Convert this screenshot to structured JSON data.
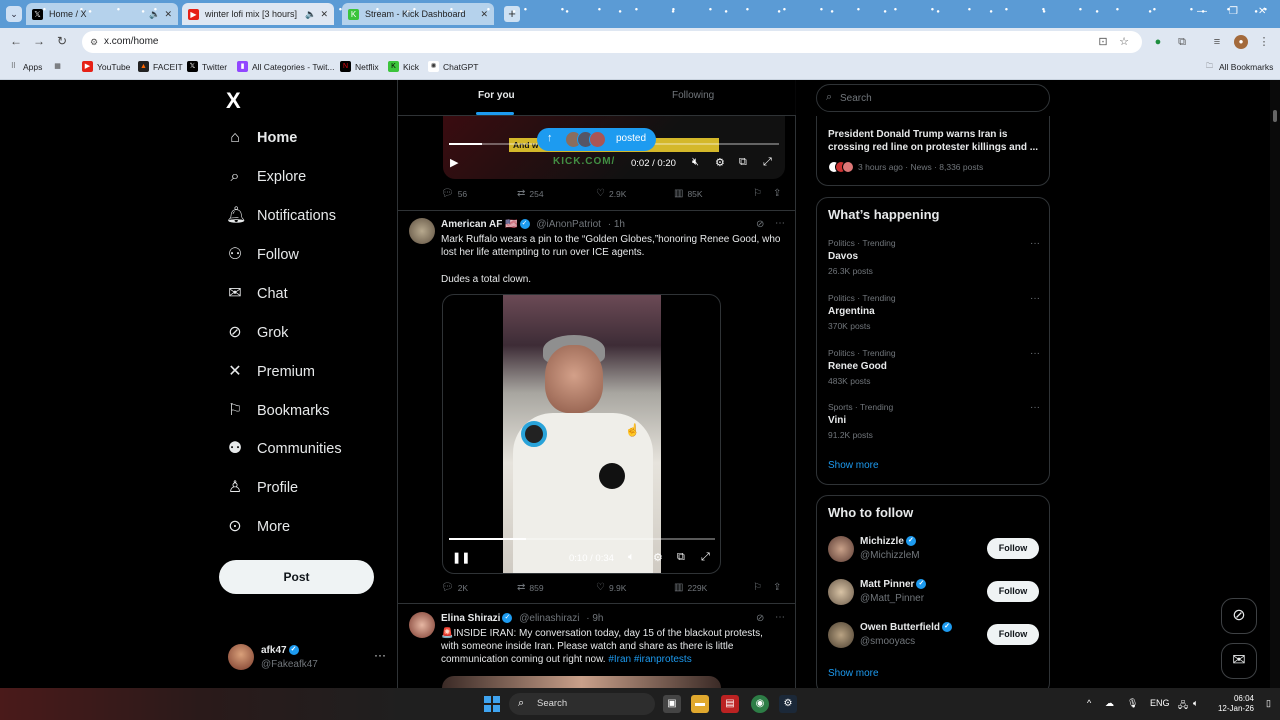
{
  "browser": {
    "tabs": [
      {
        "title": "Home / X",
        "active": false
      },
      {
        "title": "winter lofi mix [3 hours] ",
        "active": true
      },
      {
        "title": "Stream - Kick Dashboard",
        "active": false
      }
    ],
    "new_tab_glyph": "+",
    "url": "x.com/home",
    "bookmarks": [
      {
        "label": "Apps"
      },
      {
        "label": "YouTube"
      },
      {
        "label": "FACEIT"
      },
      {
        "label": "Twitter"
      },
      {
        "label": "All Categories - Twit..."
      },
      {
        "label": "Netflix"
      },
      {
        "label": "Kick"
      },
      {
        "label": "ChatGPT"
      }
    ],
    "all_bookmarks": "All Bookmarks"
  },
  "nav": {
    "logo": "X",
    "items": [
      {
        "label": "Home",
        "icon": "home-icon"
      },
      {
        "label": "Explore",
        "icon": "search-icon"
      },
      {
        "label": "Notifications",
        "icon": "bell-icon"
      },
      {
        "label": "Follow",
        "icon": "person-add-icon"
      },
      {
        "label": "Chat",
        "icon": "mail-icon"
      },
      {
        "label": "Grok",
        "icon": "grok-icon"
      },
      {
        "label": "Premium",
        "icon": "x-logo-icon"
      },
      {
        "label": "Bookmarks",
        "icon": "bookmark-icon"
      },
      {
        "label": "Communities",
        "icon": "communities-icon"
      },
      {
        "label": "Profile",
        "icon": "profile-icon"
      },
      {
        "label": "More",
        "icon": "more-circle-icon"
      }
    ],
    "post_button": "Post",
    "account": {
      "name": "afk47",
      "handle": "@Fakeafk47",
      "dots": "···"
    }
  },
  "feed": {
    "tabs": {
      "for_you": "For you",
      "following": "Following"
    },
    "posted_pill": "posted",
    "tweet1": {
      "caption": "And w                           r this country",
      "watermark": "KICK.COM/",
      "time": "0:02 / 0:20",
      "stats": {
        "replies": "56",
        "reposts": "254",
        "likes": "2.9K",
        "views": "85K"
      }
    },
    "tweet2": {
      "name": "American AF 🇺🇸",
      "handle": "@iAnonPatriot",
      "time": "· 1h",
      "text1": "Mark Ruffalo wears a pin to the “Golden Globes,”honoring Renee Good, who lost her life attempting to run over ICE agents.",
      "text2": "Dudes a total clown.",
      "video_time": "0:10 / 0:34",
      "progress": 0.29,
      "stats": {
        "replies": "2K",
        "reposts": "859",
        "likes": "9.9K",
        "views": "229K"
      }
    },
    "tweet3": {
      "name": "Elina Shirazi",
      "handle": "@elinashirazi",
      "time": "· 9h",
      "text": "🚨INSIDE IRAN: My conversation today, day 15 of the blackout protests, with someone inside Iran. Please watch and share as there is little communication coming out right now.",
      "hashtags": "#Iran #iranprotests"
    }
  },
  "right": {
    "search_placeholder": "Search",
    "news": {
      "title": "President Donald Trump warns Iran is crossing red line on protester killings and ...",
      "meta": "3 hours ago · News · 8,336 posts"
    },
    "whats_happening": "What’s happening",
    "trends": [
      {
        "category": "Politics · Trending",
        "name": "Davos",
        "count": "26.3K posts"
      },
      {
        "category": "Politics · Trending",
        "name": "Argentina",
        "count": "370K posts"
      },
      {
        "category": "Politics · Trending",
        "name": "Renee Good",
        "count": "483K posts"
      },
      {
        "category": "Sports · Trending",
        "name": "Vini",
        "count": "91.2K posts"
      }
    ],
    "show_more": "Show more",
    "who_to_follow": "Who to follow",
    "follow_suggestions": [
      {
        "name": "Michizzle",
        "handle": "@MichizzleM",
        "button": "Follow"
      },
      {
        "name": "Matt Pinner",
        "handle": "@Matt_Pinner",
        "button": "Follow"
      },
      {
        "name": "Owen Butterfield",
        "handle": "@smooyacs",
        "button": "Follow"
      }
    ],
    "show_more_2": "Show more"
  },
  "taskbar": {
    "search": "Search",
    "lang": "ENG",
    "time": "06:04",
    "date": "12-Jan-26"
  }
}
